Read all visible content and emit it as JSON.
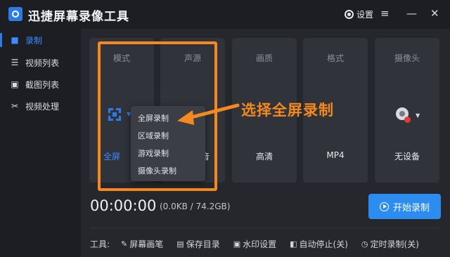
{
  "app": {
    "title": "迅捷屏幕录像工具",
    "settings_label": "设置",
    "menu_icon": "≡",
    "minimize_icon": "—",
    "close_icon": "✕"
  },
  "sidebar": {
    "items": [
      {
        "label": "录制",
        "icon": "camera-icon",
        "active": true
      },
      {
        "label": "视频列表",
        "icon": "video-list-icon",
        "active": false
      },
      {
        "label": "截图列表",
        "icon": "screenshot-list-icon",
        "active": false
      },
      {
        "label": "视频处理",
        "icon": "video-process-icon",
        "active": false
      }
    ]
  },
  "cards": [
    {
      "title": "模式",
      "value": "全屏"
    },
    {
      "title": "声源",
      "value": "系统声音"
    },
    {
      "title": "画质",
      "value": "高清"
    },
    {
      "title": "格式",
      "value": "MP4"
    },
    {
      "title": "摄像头",
      "value": "无设备"
    }
  ],
  "dropdown": {
    "items": [
      "全屏录制",
      "区域录制",
      "游戏录制",
      "摄像头录制"
    ],
    "selected": "全屏录制"
  },
  "annotation": {
    "text": "选择全屏录制",
    "color": "#f5891f"
  },
  "status": {
    "timer": "00:00:00",
    "storage": "(0.0KB / 74.2GB)"
  },
  "start_button": {
    "label": "开始录制",
    "color": "#2d8cf0"
  },
  "tools": {
    "label": "工具:",
    "items": [
      {
        "label": "屏幕画笔",
        "icon": "pen-icon"
      },
      {
        "label": "保存目录",
        "icon": "document-icon"
      },
      {
        "label": "水印设置",
        "icon": "watermark-icon"
      },
      {
        "label": "自动停止(关)",
        "icon": "auto-stop-icon"
      },
      {
        "label": "定时录制(关)",
        "icon": "clock-icon"
      }
    ]
  },
  "colors": {
    "accent": "#2f7ae5",
    "highlight": "#f5891f",
    "background": "#1f2127"
  }
}
